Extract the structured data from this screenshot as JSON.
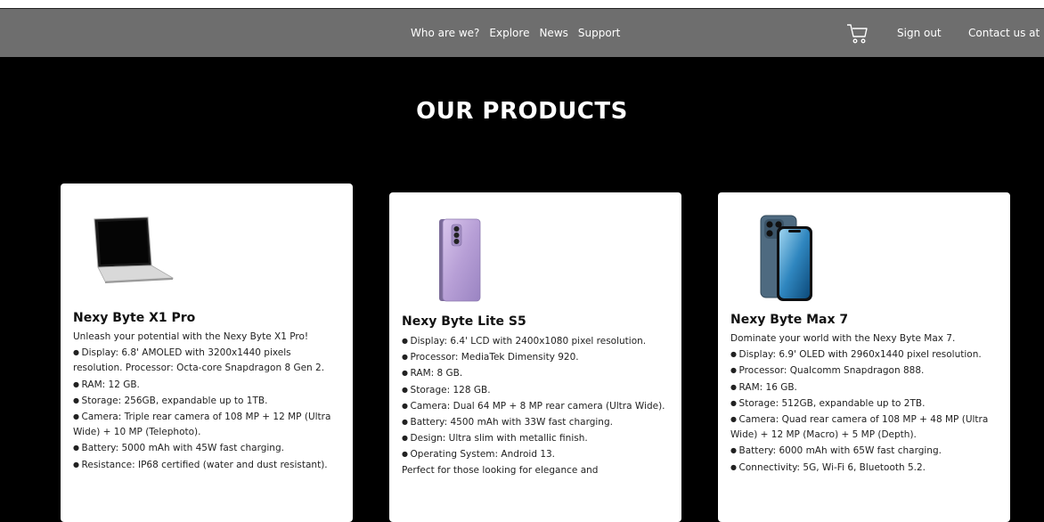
{
  "nav": {
    "links": [
      "Who are we?",
      "Explore",
      "News",
      "Support"
    ],
    "sign_out": "Sign out",
    "contact": "Contact us at"
  },
  "page": {
    "title": "OUR PRODUCTS"
  },
  "products": [
    {
      "name": "Nexy Byte X1 Pro",
      "image_icon": "laptop-icon",
      "intro": "Unleash your potential with the Nexy Byte X1 Pro!",
      "bullets": [
        "Display: 6.8' AMOLED with 3200x1440 pixels resolution. Processor: Octa-core Snapdragon 8 Gen 2.",
        "RAM: 12 GB.",
        "Storage: 256GB, expandable up to 1TB.",
        "Camera: Triple rear camera of 108 MP + 12 MP (Ultra Wide) + 10 MP (Telephoto).",
        "Battery: 5000 mAh with 45W fast charging.",
        "Resistance: IP68 certified (water and dust resistant)."
      ],
      "outro": ""
    },
    {
      "name": "Nexy Byte Lite S5",
      "image_icon": "phone-icon",
      "intro": "",
      "bullets": [
        "Display: 6.4' LCD with 2400x1080 pixel resolution.",
        "Processor: MediaTek Dimensity 920.",
        "RAM: 8 GB.",
        "Storage: 128 GB.",
        "Camera: Dual 64 MP + 8 MP rear camera (Ultra Wide).",
        "Battery: 4500 mAh with 33W fast charging.",
        "Design: Ultra slim with metallic finish.",
        "Operating System: Android 13."
      ],
      "outro": "Perfect for those looking for elegance and"
    },
    {
      "name": "Nexy Byte Max 7",
      "image_icon": "phone-icon",
      "intro": "Dominate your world with the Nexy Byte Max 7.",
      "bullets": [
        "Display: 6.9' OLED with 2960x1440 pixel resolution.",
        "Processor: Qualcomm Snapdragon 888.",
        "RAM: 16 GB.",
        "Storage: 512GB, expandable up to 2TB.",
        "Camera: Quad rear camera of 108 MP + 48 MP (Ultra Wide) + 12 MP (Macro) + 5 MP (Depth).",
        "Battery: 6000 mAh with 65W fast charging.",
        "Connectivity: 5G, Wi-Fi 6, Bluetooth 5.2."
      ],
      "outro": ""
    }
  ]
}
